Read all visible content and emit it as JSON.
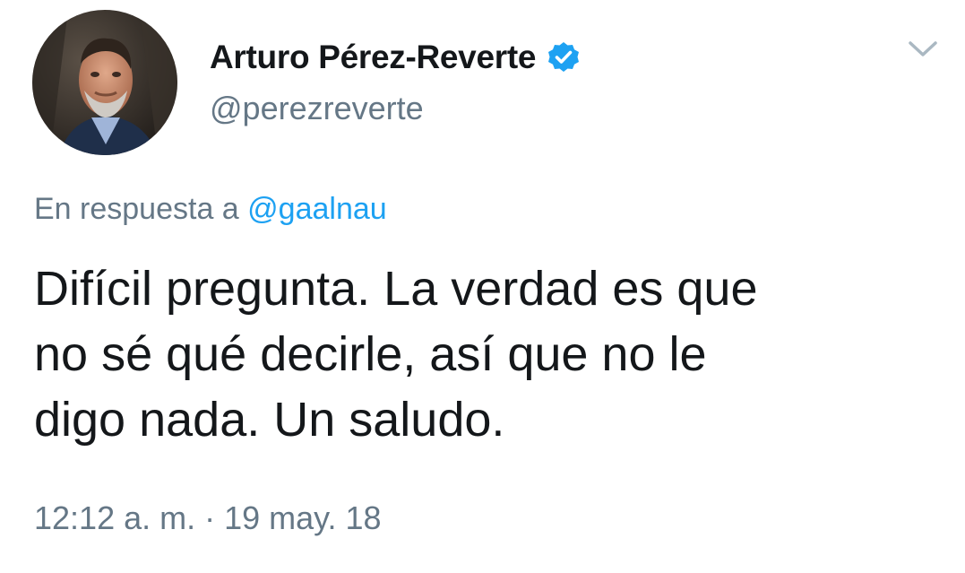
{
  "author": {
    "display_name": "Arturo Pérez-Reverte",
    "handle": "@perezreverte",
    "verified": true,
    "verified_color": "#1da1f2"
  },
  "reply": {
    "prefix": "En respuesta a",
    "mention": "@gaalnau"
  },
  "tweet": {
    "text": "Difícil pregunta. La verdad es que\nno sé qué decirle, así que no le\ndigo nada. Un saludo.",
    "timestamp": "12:12 a. m. · 19 may. 18"
  },
  "icons": {
    "avatar": "profile-photo",
    "verified": "verified-badge-icon",
    "menu": "chevron-down-icon"
  },
  "colors": {
    "text_primary": "#14171a",
    "text_secondary": "#657786",
    "link": "#1da1f2"
  }
}
